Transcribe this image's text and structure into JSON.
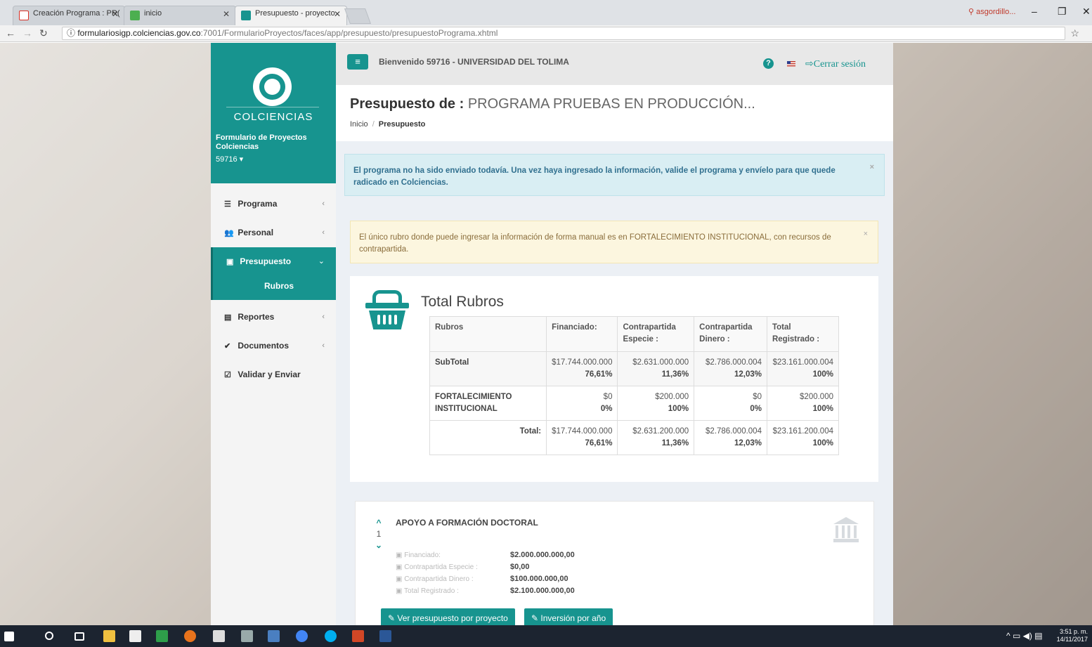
{
  "browser": {
    "tabs": [
      {
        "title": "Creación Programa : PR(",
        "color": "#d93025"
      },
      {
        "title": "inicio",
        "color": "#4caf50"
      },
      {
        "title": "Presupuesto - proyecto",
        "color": "#17948f"
      }
    ],
    "user": "asgordillo...",
    "url_host": "formulariosigp.colciencias.gov.co",
    "url_path": ":7001/FormularioProyectos/faces/app/presupuesto/presupuestoPrograma.xhtml"
  },
  "sidebar": {
    "brand": "COLCIENCIAS",
    "subtitle": "Formulario de Proyectos Colciencias",
    "user": "59716 ▾",
    "items": [
      {
        "label": "Programa",
        "icon": "list-icon",
        "glyph": "☰",
        "arrow": "‹"
      },
      {
        "label": "Personal",
        "icon": "users-icon",
        "glyph": "👥",
        "arrow": "‹"
      },
      {
        "label": "Presupuesto",
        "icon": "money-icon",
        "glyph": "▣",
        "arrow": "⌄"
      },
      {
        "label": "Rubros"
      },
      {
        "label": "Reportes",
        "icon": "file-icon",
        "glyph": "▤",
        "arrow": "‹"
      },
      {
        "label": "Documentos",
        "icon": "check-circle-icon",
        "glyph": "✔",
        "arrow": "‹"
      },
      {
        "label": "Validar y Enviar",
        "icon": "checkbox-icon",
        "glyph": "☑"
      }
    ]
  },
  "header": {
    "welcome": "Bienvenido 59716 - UNIVERSIDAD DEL TOLIMA",
    "logout": "Cerrar sesión",
    "title_bold": "Presupuesto de :",
    "title_program": "PROGRAMA PRUEBAS EN PRODUCCIÓN...",
    "breadcrumb_home": "Inicio",
    "breadcrumb_current": "Presupuesto"
  },
  "alerts": {
    "info": "El programa no ha sido enviado todavía. Una vez haya ingresado la información, valide el programa y envíelo para que quede radicado en Colciencias.",
    "warning": "El único rubro donde puede ingresar la información de forma manual es en FORTALECIMIENTO INSTITUCIONAL, con recursos de contrapartida."
  },
  "totals": {
    "title": "Total Rubros",
    "headers": [
      "Rubros",
      "Financiado:",
      "Contrapartida Especie :",
      "Contrapartida Dinero :",
      "Total Registrado :"
    ],
    "rows": [
      {
        "label": "SubTotal",
        "cells": [
          [
            "$17.744.000.000",
            "76,61%"
          ],
          [
            "$2.631.000.000",
            "11,36%"
          ],
          [
            "$2.786.000.004",
            "12,03%"
          ],
          [
            "$23.161.000.004",
            "100%"
          ]
        ]
      },
      {
        "label": "FORTALECIMIENTO INSTITUCIONAL",
        "cells": [
          [
            "$0",
            "0%"
          ],
          [
            "$200.000",
            "100%"
          ],
          [
            "$0",
            "0%"
          ],
          [
            "$200.000",
            "100%"
          ]
        ]
      },
      {
        "label": "Total:",
        "cells": [
          [
            "$17.744.000.000",
            "76,61%"
          ],
          [
            "$2.631.200.000",
            "11,36%"
          ],
          [
            "$2.786.000.004",
            "12,03%"
          ],
          [
            "$23.161.200.004",
            "100%"
          ]
        ]
      }
    ]
  },
  "project": {
    "index": "1",
    "title": "APOYO A FORMACIÓN DOCTORAL",
    "fields": [
      {
        "key": "Financiado:",
        "value": "$2.000.000.000,00"
      },
      {
        "key": "Contrapartida Especie :",
        "value": "$0,00"
      },
      {
        "key": "Contrapartida Dinero :",
        "value": "$100.000.000,00"
      },
      {
        "key": "Total Registrado :",
        "value": "$2.100.000.000,00"
      }
    ],
    "btn_project": "Ver presupuesto por proyecto",
    "btn_year": "Inversión por año"
  },
  "taskbar": {
    "time": "3:51 p. m.",
    "date": "14/11/2017"
  }
}
